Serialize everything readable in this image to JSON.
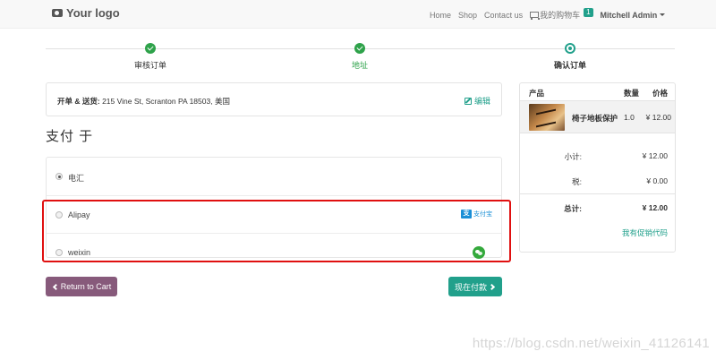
{
  "navbar": {
    "logo_text": "Your logo",
    "links": [
      "Home",
      "Shop",
      "Contact us"
    ],
    "cart_label": "我的购物车",
    "cart_count": "1",
    "user_name": "Mitchell Admin"
  },
  "wizard": {
    "steps": [
      {
        "label": "审核订单",
        "status": "done"
      },
      {
        "label": "地址",
        "status": "done"
      },
      {
        "label": "确认订单",
        "status": "current"
      }
    ]
  },
  "address": {
    "label": "开单 & 送货:",
    "value": "215 Vine St, Scranton PA 18503, 美国",
    "edit_label": "编辑"
  },
  "payment": {
    "title": "支付 于",
    "methods": [
      {
        "name": "电汇",
        "selected": true,
        "icon": "none"
      },
      {
        "name": "Alipay",
        "selected": false,
        "icon": "alipay-logo"
      },
      {
        "name": "weixin",
        "selected": false,
        "icon": "wechat-logo"
      }
    ],
    "alipay_logo_text": "支付宝"
  },
  "buttons": {
    "back_label": "Return to Cart",
    "pay_label": "现在付款"
  },
  "summary": {
    "headers": {
      "product": "产品",
      "qty": "数量",
      "price": "价格"
    },
    "product": {
      "name": "椅子地板保护",
      "qty": "1.0",
      "price": "¥ 12.00"
    },
    "subtotal": {
      "label": "小计:",
      "value": "¥ 12.00"
    },
    "tax": {
      "label": "税:",
      "value": "¥ 0.00"
    },
    "total": {
      "label": "总计:",
      "value": "¥ 12.00"
    },
    "promo_label": "我有促销代码"
  },
  "watermark": "https://blog.csdn.net/weixin_41126141",
  "colors": {
    "accent": "#21a08b",
    "step_done": "#2ea24a",
    "back_button": "#875a7b",
    "highlight": "#e01010"
  }
}
